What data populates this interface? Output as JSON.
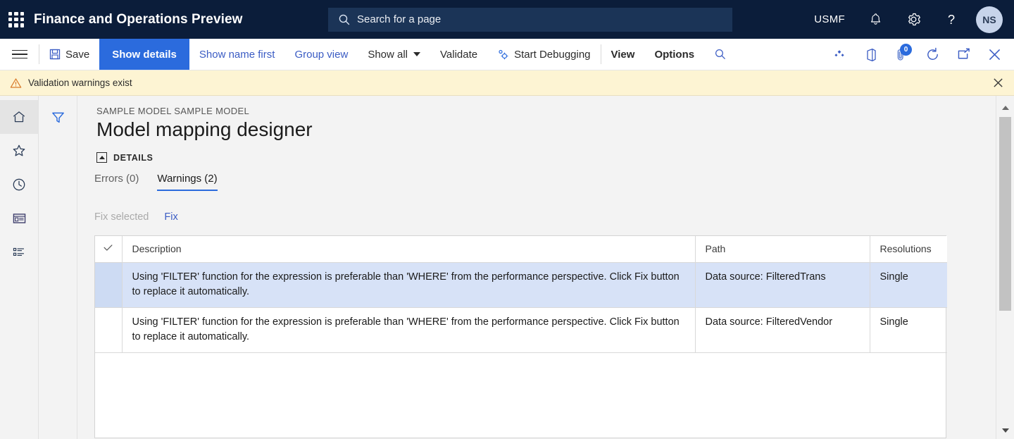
{
  "topbar": {
    "waffle_label": "App launcher",
    "app_title": "Finance and Operations Preview",
    "search_placeholder": "Search for a page",
    "company": "USMF",
    "avatar_initials": "NS",
    "icons": {
      "search": "search-icon",
      "notifications": "bell-icon",
      "settings": "gear-icon",
      "help": "question-mark-icon"
    }
  },
  "commandbar": {
    "menu_label": "Navigation menu",
    "save_label": "Save",
    "show_details_label": "Show details",
    "show_name_first_label": "Show name first",
    "group_view_label": "Group view",
    "show_all_label": "Show all",
    "validate_label": "Validate",
    "start_debugging_label": "Start Debugging",
    "view_label": "View",
    "options_label": "Options",
    "search_label": "Search",
    "share_label": "Share",
    "office_label": "Open in Microsoft Office",
    "attachments_label": "Attachments",
    "attachments_count": "0",
    "refresh_label": "Refresh",
    "popout_label": "Open in new window",
    "close_label": "Close"
  },
  "warning_bar": {
    "message": "Validation warnings exist",
    "close_label": "Close message"
  },
  "navrail": {
    "items": [
      {
        "name": "home",
        "label": "Home",
        "selected": true
      },
      {
        "name": "favorites",
        "label": "Favorites",
        "selected": false
      },
      {
        "name": "recent",
        "label": "Recent",
        "selected": false
      },
      {
        "name": "workspaces",
        "label": "Workspaces",
        "selected": false
      },
      {
        "name": "modules",
        "label": "Modules",
        "selected": false
      }
    ],
    "filter_label": "Filter"
  },
  "page": {
    "breadcrumb": "SAMPLE MODEL SAMPLE MODEL",
    "title": "Model mapping designer",
    "details_section_label": "DETAILS"
  },
  "tabs": [
    {
      "label": "Errors (0)",
      "selected": false
    },
    {
      "label": "Warnings (2)",
      "selected": true
    }
  ],
  "actions": {
    "fix_selected_label": "Fix selected",
    "fix_selected_enabled": false,
    "fix_label": "Fix",
    "fix_enabled": true
  },
  "grid": {
    "columns": [
      "",
      "Description",
      "Path",
      "Resolutions"
    ],
    "select_all_label": "Select all",
    "rows": [
      {
        "selected": true,
        "description": "Using 'FILTER' function for the expression is preferable than 'WHERE' from the performance perspective. Click Fix button to replace it automatically.",
        "path": "Data source: FilteredTrans",
        "resolutions": "Single"
      },
      {
        "selected": false,
        "description": "Using 'FILTER' function for the expression is preferable than 'WHERE' from the performance perspective. Click Fix button to replace it automatically.",
        "path": "Data source: FilteredVendor",
        "resolutions": "Single"
      }
    ]
  },
  "scrollbar": {
    "up_label": "Scroll up",
    "down_label": "Scroll down",
    "thumb_label": "Vertical scroll thumb"
  },
  "colors": {
    "nav_background": "#0b1d3a",
    "accent": "#2b6bdd",
    "link": "#3b5cc4",
    "warning_background": "#fdf4d3",
    "selected_row": "#d7e2f7"
  }
}
